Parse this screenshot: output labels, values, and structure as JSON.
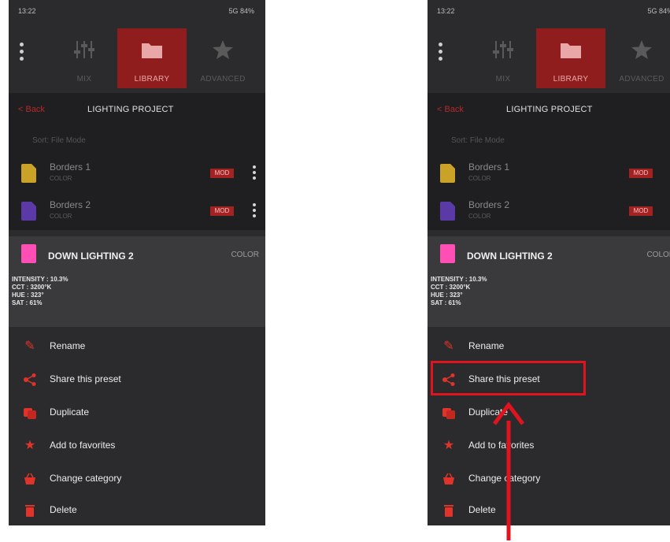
{
  "status": {
    "time": "13:22",
    "system": "5G 84%"
  },
  "tabs": [
    {
      "label": "MIX",
      "icon": "sliders-icon"
    },
    {
      "label": "LIBRARY",
      "icon": "folder-icon"
    },
    {
      "label": "ADVANCED",
      "icon": "star-icon"
    }
  ],
  "header": {
    "back_label": "< Back",
    "title": "LIGHTING PROJECT"
  },
  "sort_label": "Sort: File Mode",
  "files": [
    {
      "name": "Borders 1",
      "category": "COLOR",
      "badge": "MOD",
      "icon_color": "#c9a227"
    },
    {
      "name": "Borders 2",
      "category": "COLOR",
      "badge": "MOD",
      "icon_color": "#5b3aa8"
    }
  ],
  "preset": {
    "name": "DOWN LIGHTING 2",
    "category": "COLOR",
    "icon_color": "#ff4fb4",
    "properties": [
      "INTENSITY : 10.3%",
      "CCT : 3200°K",
      "HUE : 323°",
      "SAT : 61%"
    ]
  },
  "menu": [
    {
      "label": "Rename",
      "icon": "pencil-icon"
    },
    {
      "label": "Share this preset",
      "icon": "share-icon"
    },
    {
      "label": "Duplicate",
      "icon": "duplicate-icon"
    },
    {
      "label": "Add to favorites",
      "icon": "star-icon"
    },
    {
      "label": "Change category",
      "icon": "basket-icon"
    },
    {
      "label": "Delete",
      "icon": "trash-icon"
    }
  ],
  "colors": {
    "accent": "#e0342a",
    "highlight": "#e0141e",
    "background": "#2b2b2d"
  },
  "annotation": {
    "highlighted_item": "Share this preset"
  }
}
